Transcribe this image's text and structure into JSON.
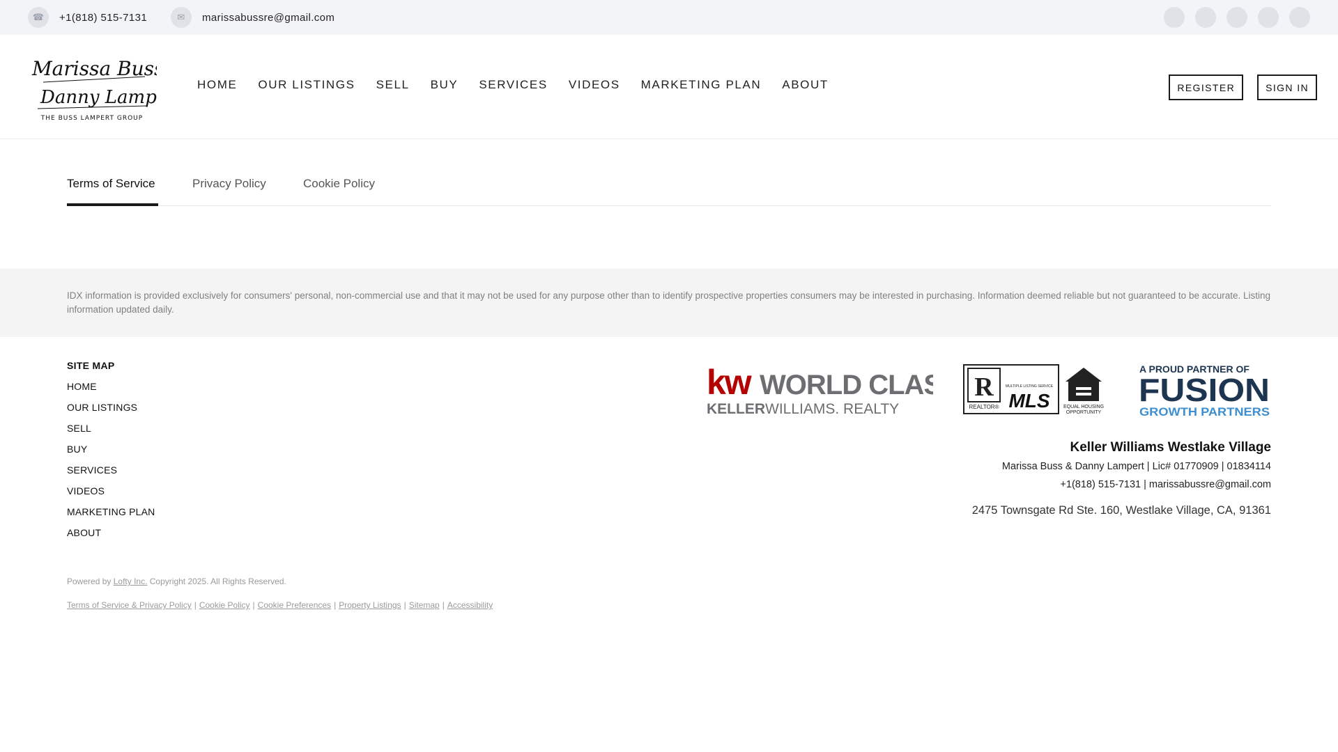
{
  "topbar": {
    "phone": "+1(818) 515-7131",
    "email": "marissabussre@gmail.com",
    "social_icons": [
      "facebook-icon",
      "instagram-icon",
      "linkedin-icon",
      "youtube-icon",
      "tiktok-icon"
    ]
  },
  "header": {
    "logo": {
      "line1": "Marissa Buss",
      "line2": "Danny Lampert",
      "tagline": "THE BUSS LAMPERT GROUP"
    },
    "nav": [
      "HOME",
      "OUR LISTINGS",
      "SELL",
      "BUY",
      "SERVICES",
      "VIDEOS",
      "MARKETING PLAN",
      "ABOUT"
    ],
    "register_label": "REGISTER",
    "signin_label": "SIGN IN"
  },
  "tabs": [
    {
      "label": "Terms of Service",
      "active": true
    },
    {
      "label": "Privacy Policy",
      "active": false
    },
    {
      "label": "Cookie Policy",
      "active": false
    }
  ],
  "idx_disclaimer": "IDX information is provided exclusively for consumers' personal, non-commercial use and that it may not be used for any purpose other than to identify prospective properties consumers may be interested in purchasing. Information deemed reliable but not guaranteed to be accurate. Listing information updated daily.",
  "sitemap": {
    "title": "SITE MAP",
    "items": [
      "HOME",
      "OUR LISTINGS",
      "SELL",
      "BUY",
      "SERVICES",
      "VIDEOS",
      "MARKETING PLAN",
      "ABOUT"
    ]
  },
  "partner_logos": {
    "kw_line1_kw": "kw",
    "kw_line1_rest": "WORLD CLASS",
    "kw_line2_a": "KELLER",
    "kw_line2_b": "WILLIAMS. REALTY",
    "realtor": "REALTOR®",
    "mls_small": "MULTIPLE LISTING SERVICE",
    "mls": "MLS",
    "eho_line1": "EQUAL HOUSING",
    "eho_line2": "OPPORTUNITY",
    "fusion_top": "A PROUD PARTNER OF",
    "fusion_main": "FUSION",
    "fusion_bottom": "GROWTH PARTNERS"
  },
  "company": {
    "name": "Keller Williams Westlake Village",
    "agents_lic": "Marissa Buss & Danny Lampert  |  Lic# 01770909 | 01834114",
    "contact": "+1(818) 515-7131  |  marissabussre@gmail.com",
    "address": "2475 Townsgate Rd Ste. 160, Westlake Village, CA, 91361"
  },
  "footer": {
    "powered_prefix": "Powered by",
    "powered_link": "Lofty Inc.",
    "copyright": "Copyright 2025. All Rights Reserved.",
    "legal_links": [
      "Terms of Service & Privacy Policy",
      "Cookie Policy",
      "Cookie Preferences",
      "Property Listings",
      "Sitemap",
      "Accessibility"
    ]
  },
  "colors": {
    "topbar_bg": "#f3f4f8",
    "kw_red": "#b40101",
    "kw_gray": "#6d6e71",
    "fusion_navy": "#1d3551",
    "fusion_blue": "#3f8fd0"
  }
}
